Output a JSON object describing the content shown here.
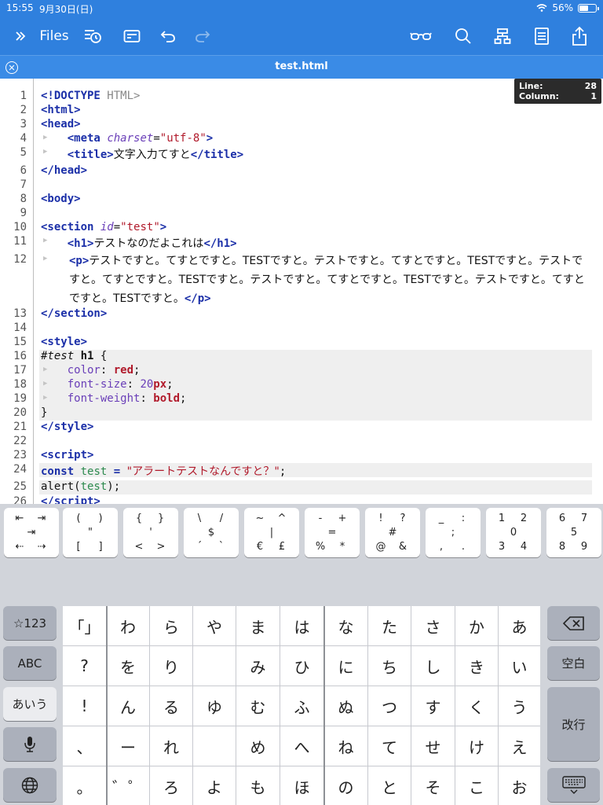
{
  "status": {
    "time": "15:55",
    "date": "9月30日(日)",
    "battery": "56%",
    "battery_level": 0.56
  },
  "toolbar": {
    "files_label": "Files"
  },
  "tab": {
    "title": "test.html"
  },
  "cursor": {
    "line_label": "Line:",
    "line": "28",
    "col_label": "Column:",
    "col": "1"
  },
  "editor": {
    "line_numbers": [
      "1",
      "2",
      "3",
      "4",
      "5",
      "6",
      "7",
      "8",
      "9",
      "10",
      "11",
      "12",
      "13",
      "14",
      "15",
      "16",
      "17",
      "18",
      "19",
      "20",
      "21",
      "22",
      "23",
      "24",
      "25",
      "26"
    ],
    "title_text": "文字入力てすと",
    "h1_text": "テストなのだよこれは",
    "p_text": "テストですと。てすとですと。TESTですと。テストですと。てすとですと。TESTですと。テストですと。てすとですと。TESTですと。テストですと。てすとですと。TESTですと。テストですと。てすとですと。TESTですと。",
    "doctype_kw": "<!DOCTYPE",
    "doctype_rest": " HTML>",
    "charset": "\"utf-8\"",
    "section_id": "\"test\"",
    "css_selector": "#test",
    "css_color": "red",
    "css_size_num": "20",
    "css_size_unit": "px",
    "css_weight": "bold",
    "js_const": "const",
    "js_var": "test",
    "js_str": "\"アラートテストなんですと？\"",
    "js_alert": "alert(",
    "js_alert_end": ");"
  },
  "symbol_keys": [
    {
      "tl": "⇤",
      "tr": "⇥",
      "ml": "",
      "mc": "⇥",
      "bl": "⇠",
      "br": "⇢"
    },
    {
      "tl": "(",
      "tr": ")",
      "mc": "\"",
      "bl": "[",
      "br": "]"
    },
    {
      "tl": "{",
      "tr": "}",
      "mc": "'",
      "bl": "<",
      "br": ">"
    },
    {
      "tl": "\\",
      "tr": "/",
      "mc": "$",
      "bl": "´",
      "br": "`"
    },
    {
      "tl": "~",
      "tr": "^",
      "mc": "|",
      "bl": "€",
      "br": "£"
    },
    {
      "tl": "-",
      "tr": "+",
      "mc": "=",
      "bl": "%",
      "br": "*"
    },
    {
      "tl": "!",
      "tr": "?",
      "mc": "#",
      "bl": "@",
      "br": "&"
    },
    {
      "tl": "_",
      "tr": ":",
      "mc": ";",
      "bl": ",",
      "br": "."
    },
    {
      "tl": "1",
      "tr": "2",
      "mc": "0",
      "bl": "3",
      "br": "4"
    },
    {
      "tl": "6",
      "tr": "7",
      "mc": "5",
      "bl": "8",
      "br": "9"
    }
  ],
  "kana_rows": [
    [
      "「」",
      "わ",
      "ら",
      "や",
      "ま",
      "は",
      "な",
      "た",
      "さ",
      "か",
      "あ"
    ],
    [
      "?",
      "を",
      "り",
      "",
      "み",
      "ひ",
      "に",
      "ち",
      "し",
      "き",
      "い"
    ],
    [
      "!",
      "ん",
      "る",
      "ゆ",
      "む",
      "ふ",
      "ぬ",
      "つ",
      "す",
      "く",
      "う"
    ],
    [
      "、",
      "ー",
      "れ",
      "",
      "め",
      "へ",
      "ね",
      "て",
      "せ",
      "け",
      "え"
    ],
    [
      "。",
      "゛゜",
      "ろ",
      "よ",
      "も",
      "ほ",
      "の",
      "と",
      "そ",
      "こ",
      "お"
    ]
  ],
  "left_keys": [
    "☆123",
    "ABC",
    "あいう",
    "",
    ""
  ],
  "right_keys": {
    "space": "空白",
    "enter": "改行"
  }
}
